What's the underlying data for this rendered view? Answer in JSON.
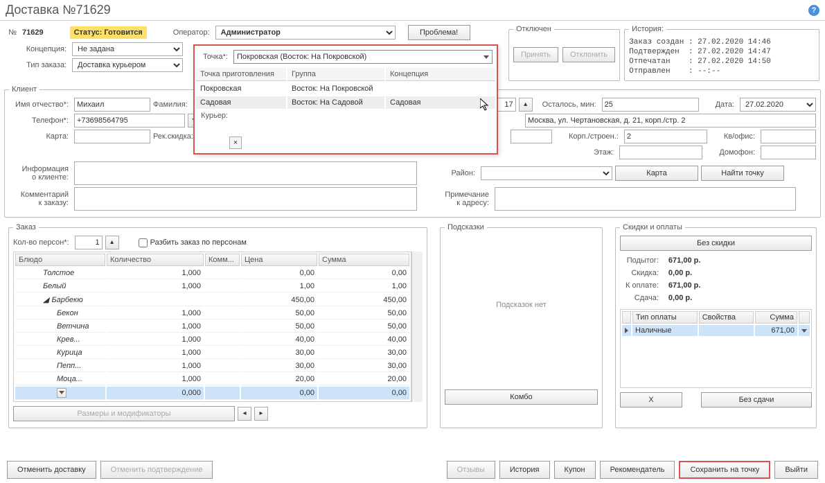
{
  "title": "Доставка №71629",
  "header": {
    "num_label": "№",
    "num_value": "71629",
    "status_label": "Статус:",
    "status_value": "Готовится",
    "operator_label": "Оператор:",
    "operator_value": "Администратор",
    "problem_btn": "Проблема!",
    "concept_label": "Концепция:",
    "concept_value": "Не задана",
    "ordertype_label": "Тип заказа:",
    "ordertype_value": "Доставка курьером"
  },
  "dropdown": {
    "point_label": "Точка*:",
    "point_value": "Покровская (Восток: На Покровской)",
    "courier_label": "Курьер:",
    "col_point": "Точка приготовления",
    "col_group": "Группа",
    "col_concept": "Концепция",
    "rows": [
      {
        "point": "Покровская",
        "group": "Восток: На Покровской",
        "concept": ""
      },
      {
        "point": "Садовая",
        "group": "Восток: На Садовой",
        "concept": "Садовая"
      }
    ]
  },
  "disabled_box": {
    "legend": "Отключен",
    "accept": "Принять",
    "decline": "Отклонить"
  },
  "history": {
    "legend": "История:",
    "lines": "Заказ создан : 27.02.2020 14:46\nПодтвержден  : 27.02.2020 14:47\nОтпечатан    : 27.02.2020 14:50\nОтправлен    : --:--"
  },
  "client": {
    "legend": "Клиент",
    "name_label": "Имя отчество*:",
    "name_value": "Михаил",
    "surname_label": "Фамилия:",
    "time_value": "17",
    "remain_label": "Осталось, мин:",
    "remain_value": "25",
    "date_label": "Дата:",
    "date_value": "27.02.2020",
    "phone_label": "Телефон*:",
    "phone_value": "+73698564795",
    "address_value": "Москва, ул. Чертановская, д. 21, корп./стр. 2",
    "card_label": "Карта:",
    "recdisc_label": "Рек.скидка:",
    "korp_label": "Корп./строен.:",
    "korp_value": "2",
    "kv_label": "Кв/офис:",
    "floor_label": "Этаж:",
    "domofon_label": "Домофон:",
    "info_label1": "Информация",
    "info_label2": "о клиенте:",
    "rayon_label": "Район:",
    "map_btn": "Карта",
    "findpoint_btn": "Найти точку",
    "comment_label1": "Комментарий",
    "comment_label2": "к заказу:",
    "prim_label1": "Примечание",
    "prim_label2": "к адресу:"
  },
  "order": {
    "legend": "Заказ",
    "persons_label": "Кол-во персон*:",
    "persons_value": "1",
    "split_label": "Разбить заказ по персонам",
    "col_dish": "Блюдо",
    "col_qty": "Количество",
    "col_comm": "Комм...",
    "col_price": "Цена",
    "col_sum": "Сумма",
    "items": [
      {
        "name": "Толстое",
        "qty": "1,000",
        "price": "0,00",
        "sum": "0,00",
        "indent": 1
      },
      {
        "name": "Белый",
        "qty": "1,000",
        "price": "1,00",
        "sum": "1,00",
        "indent": 1
      },
      {
        "name": "Барбекю",
        "qty": "",
        "price": "450,00",
        "sum": "450,00",
        "indent": 1,
        "exp": true
      },
      {
        "name": "Бекон",
        "qty": "1,000",
        "price": "50,00",
        "sum": "50,00",
        "indent": 2
      },
      {
        "name": "Ветчина",
        "qty": "1,000",
        "price": "50,00",
        "sum": "50,00",
        "indent": 2
      },
      {
        "name": "Крев...",
        "qty": "1,000",
        "price": "40,00",
        "sum": "40,00",
        "indent": 2
      },
      {
        "name": "Курица",
        "qty": "1,000",
        "price": "30,00",
        "sum": "30,00",
        "indent": 2
      },
      {
        "name": "Пепп...",
        "qty": "1,000",
        "price": "30,00",
        "sum": "30,00",
        "indent": 2
      },
      {
        "name": "Моца...",
        "qty": "1,000",
        "price": "20,00",
        "sum": "20,00",
        "indent": 2
      }
    ],
    "sel_qty": "0,000",
    "sel_price": "0,00",
    "sel_sum": "0,00",
    "mods_btn": "Размеры и модификаторы",
    "combo_btn": "Комбо"
  },
  "hints": {
    "legend": "Подсказки",
    "empty": "Подсказок нет"
  },
  "discounts": {
    "legend": "Скидки и оплаты",
    "nodisc_btn": "Без скидки",
    "subtotal_l": "Подытог:",
    "subtotal_v": "671,00 р.",
    "discount_l": "Скидка:",
    "discount_v": "0,00 р.",
    "topay_l": "К оплате:",
    "topay_v": "671,00 р.",
    "change_l": "Сдача:",
    "change_v": "0,00 р.",
    "col_type": "Тип оплаты",
    "col_props": "Свойства",
    "col_sum": "Сумма",
    "pay_type": "Наличные",
    "pay_sum": "671,00",
    "x_btn": "X",
    "nochange_btn": "Без сдачи"
  },
  "footer": {
    "cancel_delivery": "Отменить доставку",
    "cancel_confirm": "Отменить подтверждение",
    "reviews": "Отзывы",
    "history": "История",
    "coupon": "Купон",
    "recommend": "Рекомендатель",
    "save_to_point": "Сохранить на точку",
    "exit": "Выйти"
  }
}
